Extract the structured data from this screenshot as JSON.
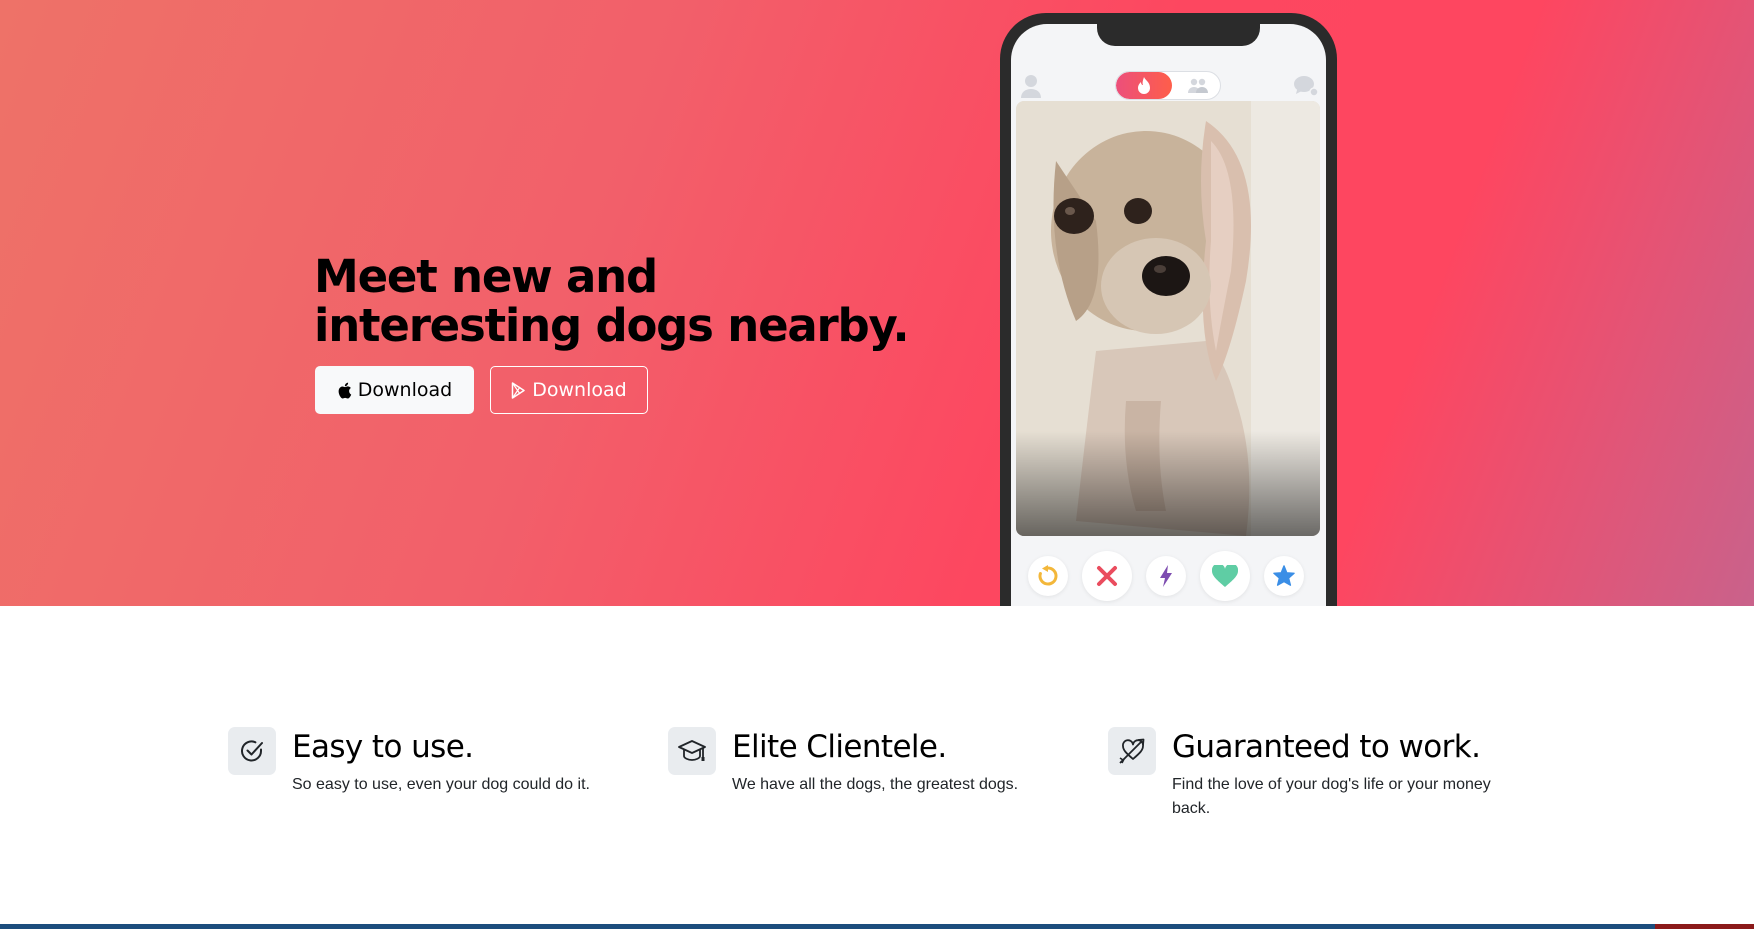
{
  "hero": {
    "headline_line1": "Meet new and",
    "headline_line2": "interesting dogs nearby.",
    "apple_button_label": "Download",
    "play_button_label": "Download"
  },
  "phone": {
    "toggle_active_icon": "flame-icon",
    "toggle_inactive_icon": "group-icon",
    "photo_subject": "dog-photo",
    "actions": [
      "rewind-icon",
      "nope-icon",
      "boost-icon",
      "like-icon",
      "super-like-icon"
    ]
  },
  "features": [
    {
      "icon": "check-circle-icon",
      "title": "Easy to use.",
      "description": "So easy to use, even your dog could do it."
    },
    {
      "icon": "graduation-cap-icon",
      "title": "Elite Clientele.",
      "description": "We have all the dogs, the greatest dogs."
    },
    {
      "icon": "heart-arrow-icon",
      "title": "Guaranteed to work.",
      "description": "Find the love of your dog's life or your money back."
    }
  ],
  "colors": {
    "brand_gradient_start": "#ee7268",
    "brand_gradient_mid": "#fd4760",
    "brand_gradient_end": "#c9628b",
    "rewind": "#f3b73a",
    "nope": "#ea4c5e",
    "boost": "#7d4cb0",
    "like": "#5fcda4",
    "super_like": "#3a8ee6"
  }
}
